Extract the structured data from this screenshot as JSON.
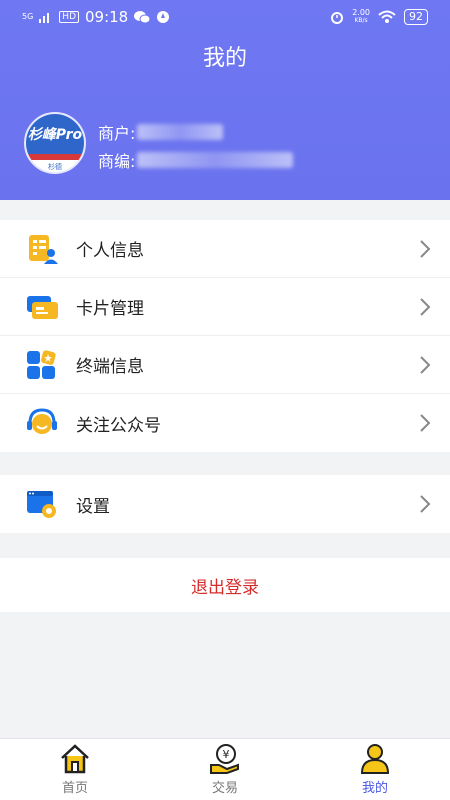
{
  "status": {
    "network": "5G",
    "hd": "HD",
    "time": "09:18",
    "speed_value": "2.00",
    "speed_unit": "KB/s",
    "battery": "92"
  },
  "header": {
    "title": "我的",
    "avatar_text": "杉峰Pro",
    "avatar_sub": "杉德",
    "merchant_label": "商户:",
    "merchant_no_label": "商编:"
  },
  "menu": {
    "group1": [
      {
        "label": "个人信息",
        "icon": "profile-doc-icon"
      },
      {
        "label": "卡片管理",
        "icon": "card-icon"
      },
      {
        "label": "终端信息",
        "icon": "terminal-grid-icon"
      },
      {
        "label": "关注公众号",
        "icon": "headset-icon"
      }
    ],
    "group2": [
      {
        "label": "设置",
        "icon": "settings-window-icon"
      }
    ]
  },
  "logout_label": "退出登录",
  "tabbar": {
    "tabs": [
      {
        "label": "首页",
        "icon": "home-icon",
        "active": false
      },
      {
        "label": "交易",
        "icon": "trade-yen-icon",
        "active": false
      },
      {
        "label": "我的",
        "icon": "user-icon",
        "active": true
      }
    ]
  },
  "colors": {
    "header_bg": "#6f78f2",
    "logout_text": "#d62b2b",
    "active_tab": "#4a57e6"
  }
}
